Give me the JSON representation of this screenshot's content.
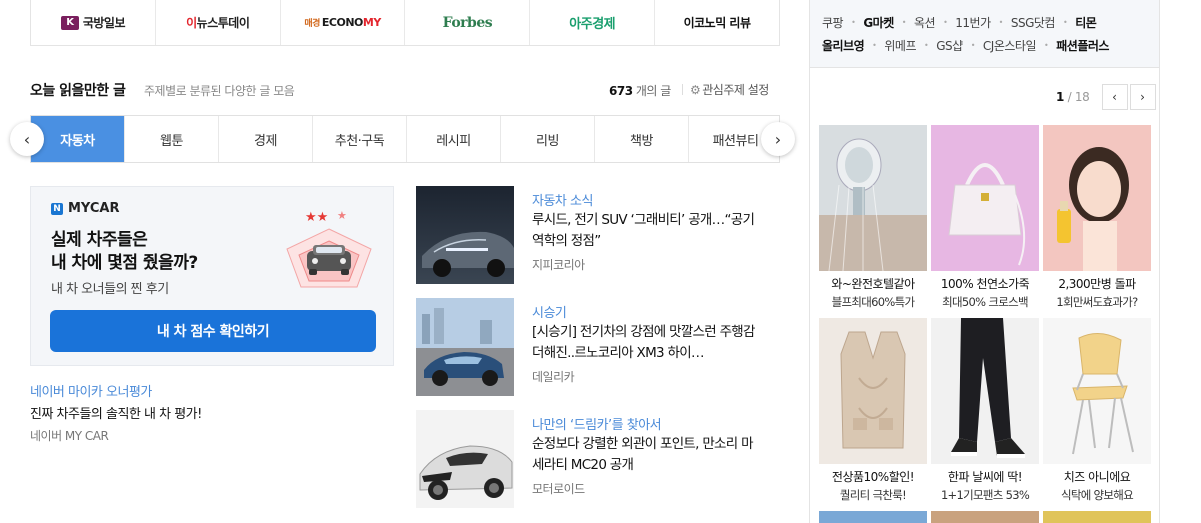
{
  "press": [
    {
      "mark": "K",
      "name": "국방일보"
    },
    {
      "lead": "이",
      "name": "뉴스투데이"
    },
    {
      "pre": "매경",
      "name": "ECONO",
      "accent": "MY"
    },
    {
      "name": "Forbes"
    },
    {
      "name": "아주경제"
    },
    {
      "name": "이코노믹 리뷰"
    }
  ],
  "section": {
    "title": "오늘 읽을만한 글",
    "subtitle": "주제별로 분류된 다양한 글 모음",
    "count": "673",
    "count_suffix": "개의 글",
    "setting": "관심주제 설정"
  },
  "tabs": [
    "자동차",
    "웹툰",
    "경제",
    "추천·구독",
    "레시피",
    "리빙",
    "책방",
    "패션뷰티"
  ],
  "mycar": {
    "logo": "MYCAR",
    "headline1": "실제 차주들은",
    "headline2": "내 차에 몇점 줬을까?",
    "desc": "내 차 오너들의 찐 후기",
    "button": "내 차 점수 확인하기",
    "category": "네이버 마이카 오너평가",
    "title": "진짜 차주들의 솔직한 내 차 평가!",
    "source": "네이버 MY CAR"
  },
  "articles": [
    {
      "category": "자동차 소식",
      "title": "루시드, 전기 SUV ‘그래비티’ 공개…“공기역학의 정점”",
      "source": "지피코리아"
    },
    {
      "category": "시승기",
      "title": "[시승기] 전기차의 강점에 맛깔스런 주행감 더해진..르노코리아 XM3 하이…",
      "source": "데일리카"
    },
    {
      "category": "나만의 ‘드림카’를 찾아서",
      "title": "순정보다 강렬한 외관이 포인트, 만소리 마세라티 MC20 공개",
      "source": "모터로이드"
    }
  ],
  "shops": {
    "row1": [
      "쿠팡",
      "G마켓",
      "옥션",
      "11번가",
      "SSG닷컴",
      "티몬"
    ],
    "row2": [
      "올리브영",
      "위메프",
      "GS샵",
      "CJ온스타일",
      "패션플러스"
    ]
  },
  "pager": {
    "current": "1",
    "total": "/ 18"
  },
  "products": [
    {
      "name": "와~완전호텔같아",
      "sub": "블프최대60%특가"
    },
    {
      "name": "100% 천연소가죽",
      "sub": "최대50% 크로스백"
    },
    {
      "name": "2,300만병 돌파",
      "sub": "1회만써도효과가?"
    },
    {
      "name": "전상품10%할인!",
      "sub": "퀄리티 극찬룩!"
    },
    {
      "name": "한파 날씨에 딱!",
      "sub": "1+1기모팬츠 53%"
    },
    {
      "name": "치즈 아니에요",
      "sub": "식탁에 양보해요"
    }
  ]
}
